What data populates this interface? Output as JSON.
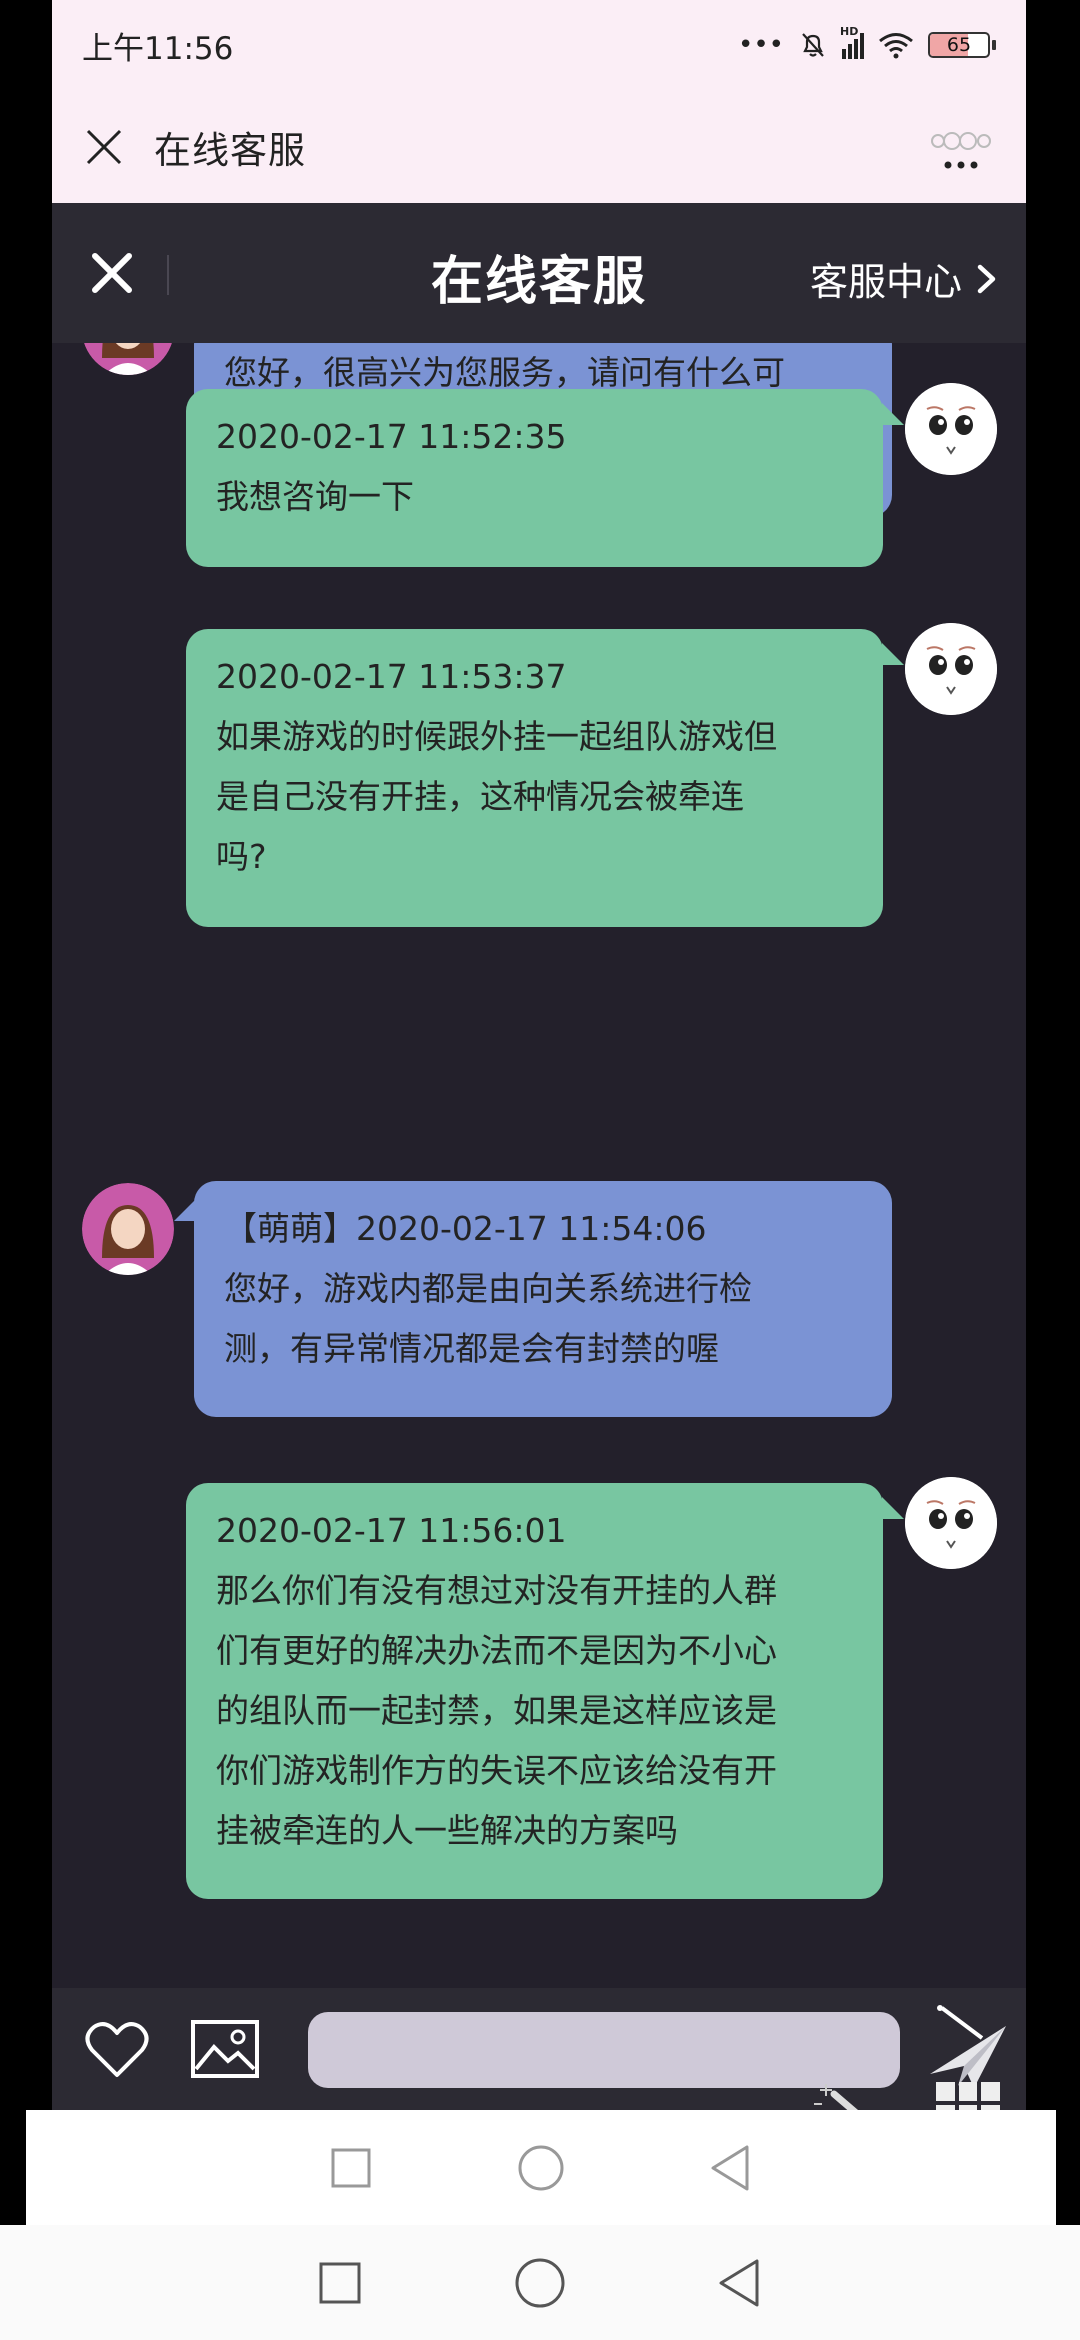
{
  "status_bar": {
    "time": "上午11:56",
    "network_label": "HD",
    "battery_level": "65",
    "battery_percent": 65
  },
  "web_header": {
    "title": "在线客服"
  },
  "app_header": {
    "title": "在线客服",
    "right_link": "客服中心"
  },
  "messages": [
    {
      "sender": "agent",
      "meta": "",
      "text": "您好，很高兴为您服务，请问有什么可\n以帮到您的?"
    },
    {
      "sender": "user",
      "meta": "2020-02-17 11:52:35",
      "text": "我想咨询一下"
    },
    {
      "sender": "user",
      "meta": "2020-02-17 11:53:37",
      "text": "如果游戏的时候跟外挂一起组队游戏但\n是自己没有开挂，这种情况会被牵连\n吗?"
    },
    {
      "sender": "agent",
      "meta": "【萌萌】2020-02-17 11:54:06",
      "text": "您好，游戏内都是由向关系统进行检\n测，有异常情况都是会有封禁的喔"
    },
    {
      "sender": "user",
      "meta": "2020-02-17 11:56:01",
      "text": "那么你们有没有想过对没有开挂的人群\n们有更好的解决办法而不是因为不小心\n的组队而一起封禁，如果是这样应该是\n你们游戏制作方的失误不应该给没有开\n挂被牵连的人一些解决的方案吗"
    }
  ],
  "input_bar": {
    "placeholder": ""
  },
  "icons": {
    "close": "close-icon",
    "more": "more-icon",
    "chevron": "chevron-right-icon",
    "heart": "heart-icon",
    "image": "image-icon",
    "send": "send-icon",
    "grid": "grid-icon"
  },
  "colors": {
    "agent_bubble": "#7b93d4",
    "user_bubble": "#78c6a1",
    "chat_background": "#23202b",
    "header_background": "#2c2a33"
  }
}
